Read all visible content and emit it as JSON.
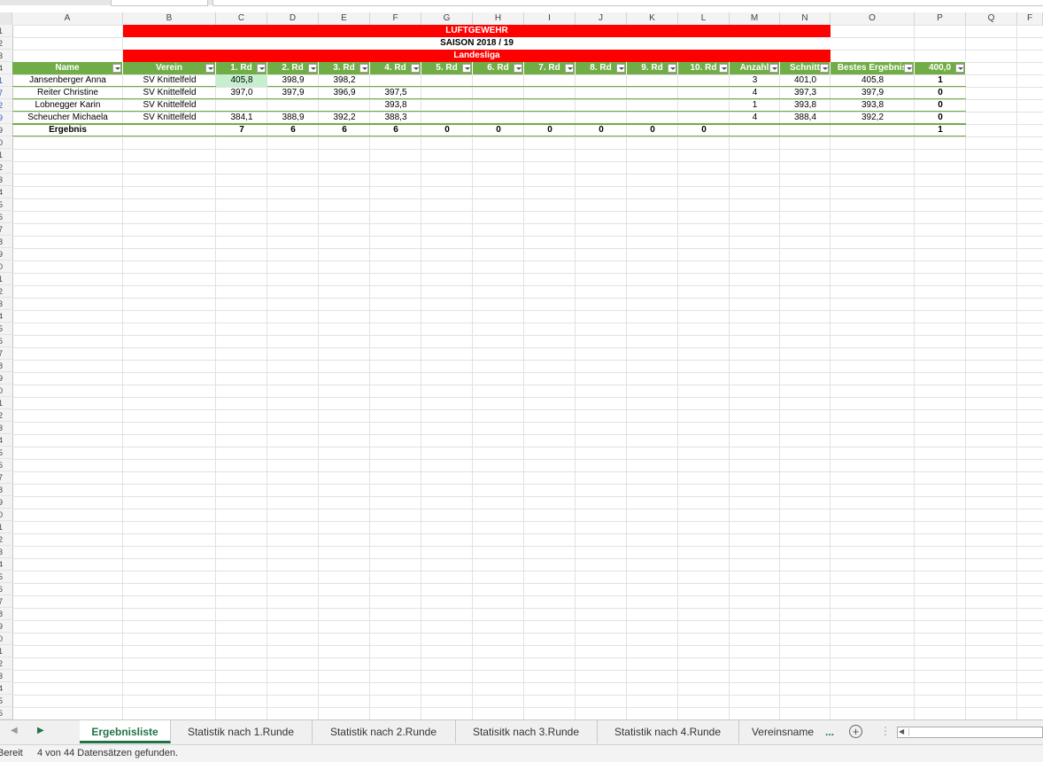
{
  "columns": [
    "A",
    "B",
    "C",
    "D",
    "E",
    "F",
    "G",
    "H",
    "I",
    "J",
    "K",
    "L",
    "M",
    "N",
    "O",
    "P",
    "Q",
    "F"
  ],
  "rows": [
    "1",
    "2",
    "3",
    "4",
    "1",
    "7",
    "2",
    "9",
    "9",
    "0",
    "1",
    "2",
    "3",
    "4",
    "5",
    "6",
    "7",
    "8",
    "9",
    "0",
    "1",
    "2",
    "3",
    "4",
    "5",
    "6",
    "7",
    "8",
    "9",
    "0",
    "1",
    "2",
    "3",
    "4",
    "5",
    "6",
    "7",
    "8",
    "9",
    "0",
    "1",
    "2",
    "3",
    "4",
    "5",
    "6",
    "7",
    "8",
    "9",
    "0",
    "1",
    "2",
    "3",
    "4",
    "5",
    "6"
  ],
  "banner": {
    "title": "LUFTGEWEHR",
    "season": "SAISON 2018 / 19",
    "league": "Landesliga"
  },
  "headers": [
    "Name",
    "Verein",
    "1. Rd",
    "2. Rd",
    "3. Rd",
    "4. Rd",
    "5. Rd",
    "6. Rd",
    "7. Rd",
    "8. Rd",
    "9. Rd",
    "10. Rd",
    "Anzahl",
    "Schnitt",
    "Bestes Ergebnis",
    "400,0"
  ],
  "data_rows": [
    {
      "name": "Jansenberger Anna",
      "verein": "SV Knittelfeld",
      "rd1": "405,8",
      "rd2": "398,9",
      "rd3": "398,2",
      "rd4": "",
      "anzahl": "3",
      "schnitt": "401,0",
      "bestes": "405,8",
      "p": "1"
    },
    {
      "name": "Reiter Christine",
      "verein": "SV Knittelfeld",
      "rd1": "397,0",
      "rd2": "397,9",
      "rd3": "396,9",
      "rd4": "397,5",
      "anzahl": "4",
      "schnitt": "397,3",
      "bestes": "397,9",
      "p": "0"
    },
    {
      "name": "Lobnegger Karin",
      "verein": "SV Knittelfeld",
      "rd1": "",
      "rd2": "",
      "rd3": "",
      "rd4": "393,8",
      "anzahl": "1",
      "schnitt": "393,8",
      "bestes": "393,8",
      "p": "0"
    },
    {
      "name": "Scheucher Michaela",
      "verein": "SV Knittelfeld",
      "rd1": "384,1",
      "rd2": "388,9",
      "rd3": "392,2",
      "rd4": "388,3",
      "anzahl": "4",
      "schnitt": "388,4",
      "bestes": "392,2",
      "p": "0"
    }
  ],
  "totals": {
    "label": "Ergebnis",
    "values": [
      "7",
      "6",
      "6",
      "6",
      "0",
      "0",
      "0",
      "0",
      "0",
      "0"
    ],
    "p": "1"
  },
  "sheet_tabs": [
    "Ergebnisliste",
    "Statistik nach 1.Runde",
    "Statistik nach 2.Runde",
    "Statisitk nach 3.Runde",
    "Statistik nach 4.Runde",
    "Vereinsname"
  ],
  "tab_more": "...",
  "status": {
    "mode": "Bereit",
    "message": "4 von 44 Datensätzen gefunden."
  },
  "colors": {
    "banner_red": "#ff0000",
    "header_green": "#70ad47",
    "excel_green": "#217346",
    "highlight": "#c6efce"
  }
}
